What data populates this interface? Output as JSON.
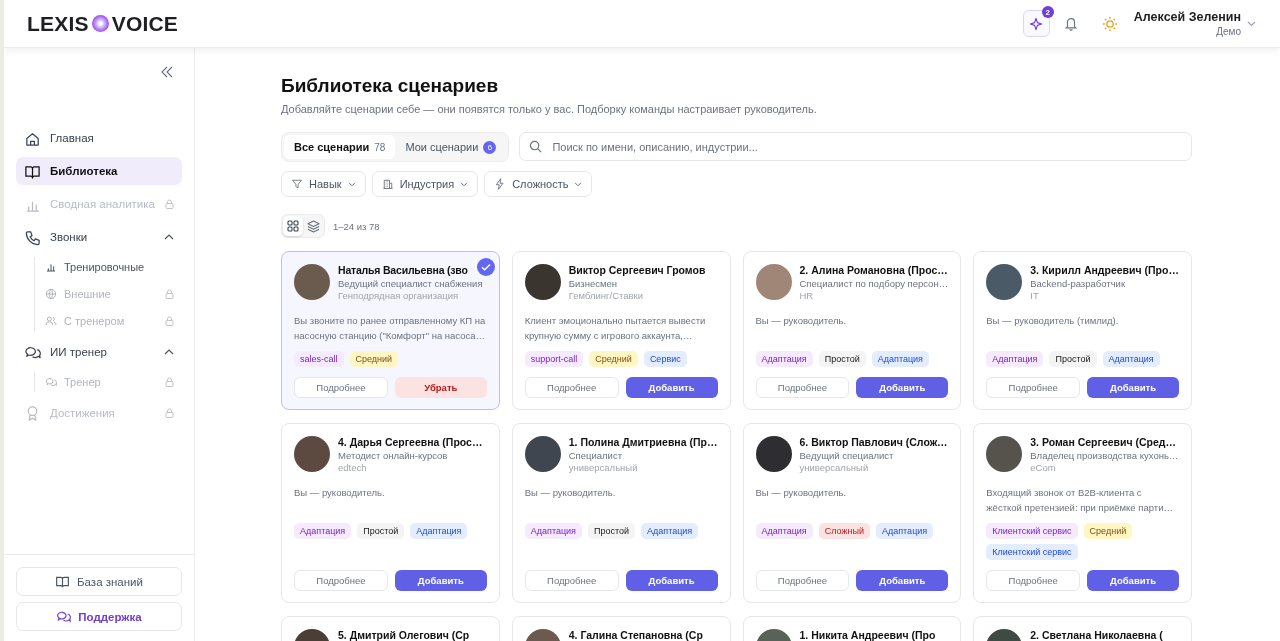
{
  "header": {
    "logo_left": "LEXIS",
    "logo_right": "VOICE",
    "ai_badge": "2",
    "user_name": "Алексей Зеленин",
    "user_role": "Демо"
  },
  "sidebar": {
    "items": [
      {
        "label": "Главная",
        "selected": false,
        "locked": false
      },
      {
        "label": "Библиотека",
        "selected": true,
        "locked": false
      },
      {
        "label": "Сводная аналитика",
        "selected": false,
        "locked": true
      },
      {
        "label": "Звонки",
        "selected": false,
        "locked": false,
        "expanded": true,
        "children": [
          {
            "label": "Тренировочные",
            "locked": false
          },
          {
            "label": "Внешние",
            "locked": true
          },
          {
            "label": "С тренером",
            "locked": true
          }
        ]
      },
      {
        "label": "ИИ тренер",
        "selected": false,
        "locked": false,
        "expanded": true,
        "children": [
          {
            "label": "Тренер",
            "locked": true
          }
        ]
      },
      {
        "label": "Достижения",
        "selected": false,
        "locked": true
      }
    ],
    "footer_buttons": [
      {
        "label": "База знаний",
        "kind": "plain"
      },
      {
        "label": "Поддержка",
        "kind": "accent"
      }
    ]
  },
  "page": {
    "title": "Библиотека сценариев",
    "subtitle": "Добавляйте сценарии себе — они появятся только у вас. Подборку команды настраивает руководитель.",
    "tabs": [
      {
        "label": "Все сценарии",
        "count": "78",
        "selected": true
      },
      {
        "label": "Мои сценарии",
        "count": "6",
        "selected": false
      }
    ],
    "search": {
      "placeholder": "Поиск по имени, описанию, индустрии..."
    },
    "filters": [
      "Навык",
      "Индустрия",
      "Сложность"
    ],
    "views": [
      {
        "selected": true
      },
      {
        "selected": false
      }
    ],
    "range": "1–24 из 78"
  },
  "cards": [
    {
      "name": "Наталья Васильевна (зво",
      "role": "Ведущий специалист снабжения",
      "industry": "Генподрядная организация",
      "description": "Вы звоните по ранее отправленному КП на насосную станцию (\"Комфорт\" на насоса…",
      "tags": [
        {
          "label": "sales-call",
          "kind": "skill"
        },
        {
          "label": "Средний",
          "kind": "medium"
        }
      ],
      "selected": true,
      "details": "Подробнее",
      "action": "Убрать"
    },
    {
      "name": "Виктор Сергеевич Громов",
      "role": "Бизнесмен",
      "industry": "Гемблинг/Ставки",
      "description": "Клиент эмоционально пытается вывести крупную сумму с игрового аккаунта,…",
      "tags": [
        {
          "label": "support-call",
          "kind": "skill"
        },
        {
          "label": "Средний",
          "kind": "medium"
        },
        {
          "label": "Сервис",
          "kind": "area"
        }
      ],
      "selected": false,
      "details": "Подробнее",
      "action": "Добавить"
    },
    {
      "name": "2. Алина Романовна (Прос…",
      "role": "Специалист по подбору персон…",
      "industry": "HR",
      "description": "Вы — руководитель.",
      "tags": [
        {
          "label": "Адаптация",
          "kind": "skill"
        },
        {
          "label": "Простой",
          "kind": "easy"
        },
        {
          "label": "Адаптация",
          "kind": "area"
        }
      ],
      "selected": false,
      "details": "Подробнее",
      "action": "Добавить"
    },
    {
      "name": "3. Кирилл Андреевич (Про…",
      "role": "Backend-разработчик",
      "industry": "IT",
      "description": "Вы — руководитель (тимлид).",
      "tags": [
        {
          "label": "Адаптация",
          "kind": "skill"
        },
        {
          "label": "Простой",
          "kind": "easy"
        },
        {
          "label": "Адаптация",
          "kind": "area"
        }
      ],
      "selected": false,
      "details": "Подробнее",
      "action": "Добавить"
    },
    {
      "name": "4. Дарья Сергеевна (Прос…",
      "role": "Методист онлайн-курсов",
      "industry": "edtech",
      "description": "Вы — руководитель.",
      "tags": [
        {
          "label": "Адаптация",
          "kind": "skill"
        },
        {
          "label": "Простой",
          "kind": "easy"
        },
        {
          "label": "Адаптация",
          "kind": "area"
        }
      ],
      "selected": false,
      "details": "Подробнее",
      "action": "Добавить"
    },
    {
      "name": "1. Полина Дмитриевна (Пр…",
      "role": "Специалист",
      "industry": "универсальный",
      "description": "Вы — руководитель.",
      "tags": [
        {
          "label": "Адаптация",
          "kind": "skill"
        },
        {
          "label": "Простой",
          "kind": "easy"
        },
        {
          "label": "Адаптация",
          "kind": "area"
        }
      ],
      "selected": false,
      "details": "Подробнее",
      "action": "Добавить"
    },
    {
      "name": "6. Виктор Павлович (Слож…",
      "role": "Ведущий специалист",
      "industry": "универсальный",
      "description": "Вы — руководитель.",
      "tags": [
        {
          "label": "Адаптация",
          "kind": "skill"
        },
        {
          "label": "Сложный",
          "kind": "hard"
        },
        {
          "label": "Адаптация",
          "kind": "area"
        }
      ],
      "selected": false,
      "details": "Подробнее",
      "action": "Добавить"
    },
    {
      "name": "3. Роман Сергеевич (Сред…",
      "role": "Владелец производства кухонь…",
      "industry": "eCom",
      "description": "Входящий звонок от B2B-клиента с жёсткой претензией: при приёмке парти…",
      "tags": [
        {
          "label": "Клиентский сервис",
          "kind": "skill"
        },
        {
          "label": "Средний",
          "kind": "medium"
        },
        {
          "label": "Клиентский сервис",
          "kind": "area"
        }
      ],
      "selected": false,
      "details": "Подробнее",
      "action": "Добавить"
    },
    {
      "name": "5. Дмитрий Олегович (Ср"
    },
    {
      "name": "4. Галина Степановна (Ср"
    },
    {
      "name": "1. Никита Андреевич (Про"
    },
    {
      "name": "2. Светлана Николаевна ("
    }
  ]
}
